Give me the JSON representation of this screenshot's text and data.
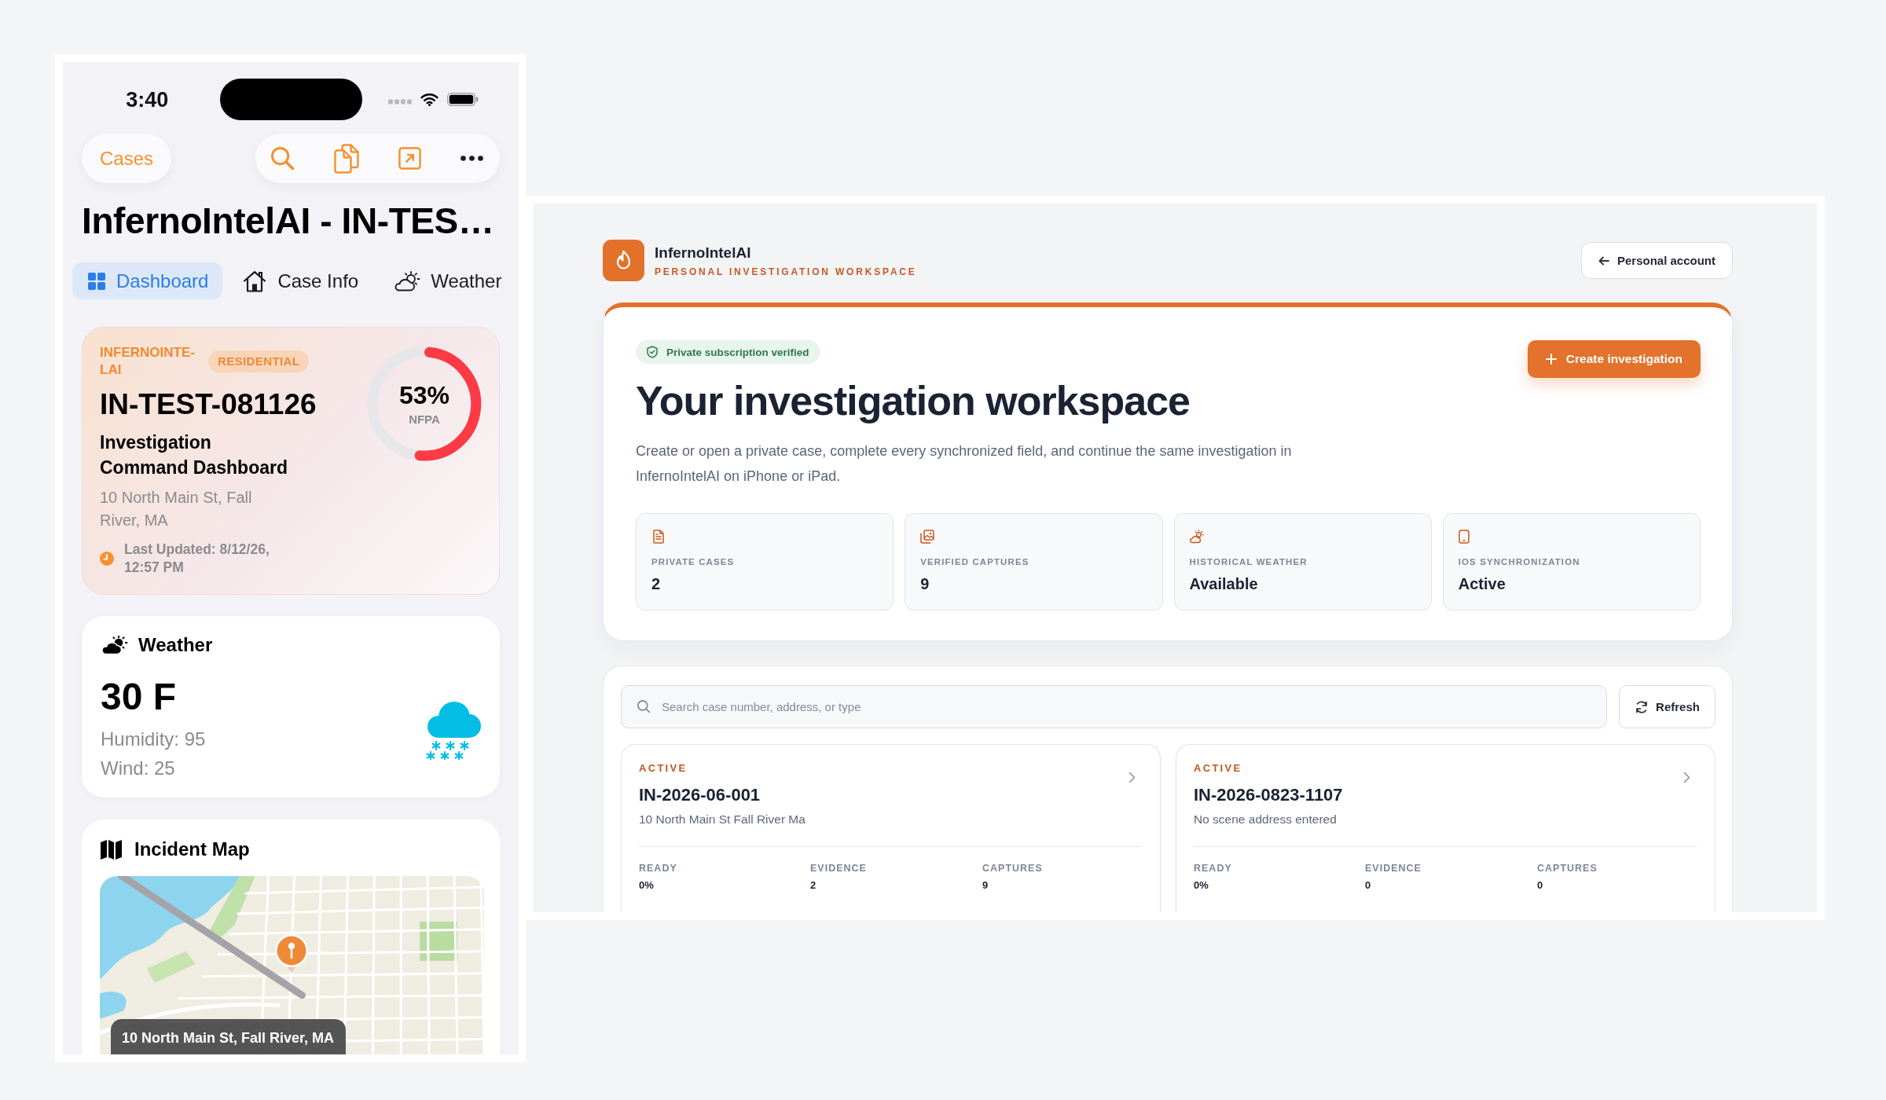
{
  "phone": {
    "status_bar": {
      "time": "3:40"
    },
    "nav": {
      "back_label": "Cases"
    },
    "title": "InfernoIntelAI - IN-TES…",
    "tabs": [
      {
        "label": "Dashboard",
        "selected": true
      },
      {
        "label": "Case Info",
        "selected": false
      },
      {
        "label": "Weather",
        "selected": false
      }
    ],
    "case_card": {
      "organization": "INFERNOINTE-LAI",
      "category": "RESIDENTIAL",
      "case_number": "IN-TEST-081126",
      "subtitle": "Investigation Command Dashboard",
      "address": "10 North Main St, Fall River, MA",
      "last_updated": "Last Updated: 8/12/26, 12:57 PM",
      "nfpa": {
        "level": 0.53,
        "reading": "53%",
        "label": "NFPA"
      }
    },
    "weather_card": {
      "title": "Weather",
      "temperature": "30 F",
      "humidity": "Humidity: 95",
      "wind": "Wind: 25"
    },
    "map_card": {
      "title": "Incident Map",
      "caption": "10 North Main St, Fall River, MA"
    }
  },
  "web": {
    "brand": {
      "name": "InfernoIntelAI",
      "tagline": "PERSONAL INVESTIGATION WORKSPACE"
    },
    "account_button": "Personal account",
    "hero": {
      "badge": "Private subscription verified",
      "title": "Your investigation workspace",
      "description": "Create or open a private case, complete every synchronized field, and continue the same investigation in InfernoIntelAI on iPhone or iPad.",
      "create_button": "Create investigation",
      "stats": [
        {
          "label": "PRIVATE CASES",
          "value": "2"
        },
        {
          "label": "VERIFIED CAPTURES",
          "value": "9"
        },
        {
          "label": "HISTORICAL WEATHER",
          "value": "Available"
        },
        {
          "label": "IOS SYNCHRONIZATION",
          "value": "Active"
        }
      ]
    },
    "search": {
      "placeholder": "Search case number, address, or type"
    },
    "refresh_button": "Refresh",
    "cases": [
      {
        "status": "ACTIVE",
        "case_number": "IN-2026-06-001",
        "address": "10 North Main St Fall River Ma",
        "metrics": [
          {
            "label": "READY",
            "value": "0%"
          },
          {
            "label": "EVIDENCE",
            "value": "2"
          },
          {
            "label": "CAPTURES",
            "value": "9"
          }
        ]
      },
      {
        "status": "ACTIVE",
        "case_number": "IN-2026-0823-1107",
        "address": "No scene address entered",
        "metrics": [
          {
            "label": "READY",
            "value": "0%"
          },
          {
            "label": "EVIDENCE",
            "value": "0"
          },
          {
            "label": "CAPTURES",
            "value": "0"
          }
        ]
      }
    ]
  }
}
